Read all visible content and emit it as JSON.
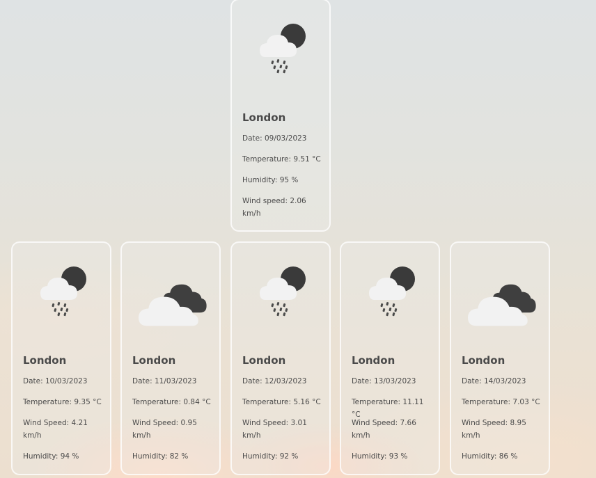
{
  "today": {
    "city": "London",
    "date_label": "Date: 09/03/2023",
    "temperature_label": "Temperature: 9.51 °C",
    "humidity_label": "Humidity: 95 %",
    "wind_label": "Wind speed: 2.06 km/h",
    "icon": "cloud-moon-rain-icon"
  },
  "forecast": [
    {
      "city": "London",
      "date_label": "Date: 10/03/2023",
      "temperature_label": "Temperature: 9.35 °C",
      "wind_label": "Wind Speed: 4.21 km/h",
      "humidity_label": "Humidity: 94 %",
      "icon": "cloud-moon-rain-icon"
    },
    {
      "city": "London",
      "date_label": "Date: 11/03/2023",
      "temperature_label": "Temperature: 0.84 °C",
      "wind_label": "Wind Speed: 0.95 km/h",
      "humidity_label": "Humidity: 82 %",
      "icon": "cloud-dark-cloud-icon"
    },
    {
      "city": "London",
      "date_label": "Date: 12/03/2023",
      "temperature_label": "Temperature: 5.16 °C",
      "wind_label": "Wind Speed: 3.01 km/h",
      "humidity_label": "Humidity: 92 %",
      "icon": "cloud-moon-rain-icon"
    },
    {
      "city": "London",
      "date_label": "Date: 13/03/2023",
      "temperature_label": "Temperature: 11.11 °C",
      "wind_label": "Wind Speed: 7.66 km/h",
      "humidity_label": "Humidity: 93 %",
      "icon": "cloud-moon-rain-icon"
    },
    {
      "city": "London",
      "date_label": "Date: 14/03/2023",
      "temperature_label": "Temperature: 7.03 °C",
      "wind_label": "Wind Speed: 8.95 km/h",
      "humidity_label": "Humidity: 86 %",
      "icon": "cloud-dark-cloud-icon"
    }
  ]
}
